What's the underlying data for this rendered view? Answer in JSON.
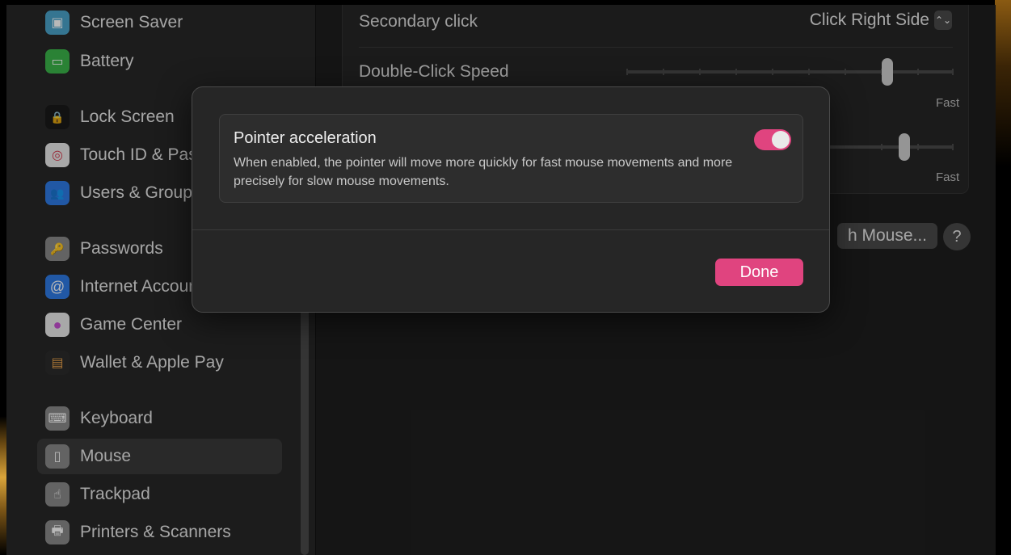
{
  "sidebar": {
    "items": [
      {
        "label": "Screen Saver",
        "icon": "screen-saver-icon",
        "color": "#4aa3c9",
        "glyph": "▣"
      },
      {
        "label": "Battery",
        "icon": "battery-icon",
        "color": "#3bb54a",
        "glyph": "▭"
      },
      {
        "label": "Lock Screen",
        "icon": "lock-icon",
        "color": "#1a1a1a",
        "glyph": "🔒"
      },
      {
        "label": "Touch ID & Password",
        "icon": "fingerprint-icon",
        "color": "#e9e9e9",
        "glyph": "◎"
      },
      {
        "label": "Users & Groups",
        "icon": "users-icon",
        "color": "#2f7ae5",
        "glyph": "👥"
      },
      {
        "label": "Passwords",
        "icon": "key-icon",
        "color": "#8a8a8a",
        "glyph": "🔑"
      },
      {
        "label": "Internet Accounts",
        "icon": "at-icon",
        "color": "#2f7ae5",
        "glyph": "@"
      },
      {
        "label": "Game Center",
        "icon": "game-center-icon",
        "color": "#e9e9e9",
        "glyph": "●"
      },
      {
        "label": "Wallet & Apple Pay",
        "icon": "wallet-icon",
        "color": "#2b2b2b",
        "glyph": "▤"
      },
      {
        "label": "Keyboard",
        "icon": "keyboard-icon",
        "color": "#8a8a8a",
        "glyph": "⌨"
      },
      {
        "label": "Mouse",
        "icon": "mouse-icon",
        "color": "#8a8a8a",
        "glyph": "▯"
      },
      {
        "label": "Trackpad",
        "icon": "trackpad-icon",
        "color": "#8a8a8a",
        "glyph": "☝"
      },
      {
        "label": "Printers & Scanners",
        "icon": "printer-icon",
        "color": "#8a8a8a",
        "glyph": "🖶"
      }
    ]
  },
  "settings": {
    "secondary_click_label": "Secondary click",
    "secondary_click_value": "Click Right Side",
    "stepper_glyph": "⌃⌄",
    "double_click_label": "Double-Click Speed",
    "fast_label_1": "Fast",
    "fast_label_2": "Fast",
    "double_click_level": 0.85,
    "tracking_level": 0.85,
    "bluetooth_button_label": "h Mouse...",
    "help_label": "?"
  },
  "sheet": {
    "title": "Pointer acceleration",
    "description": "When enabled, the pointer will move more quickly for fast mouse movements and more precisely for slow mouse movements.",
    "toggle_on": true,
    "done_label": "Done"
  },
  "colors": {
    "accent": "#e0447f"
  }
}
